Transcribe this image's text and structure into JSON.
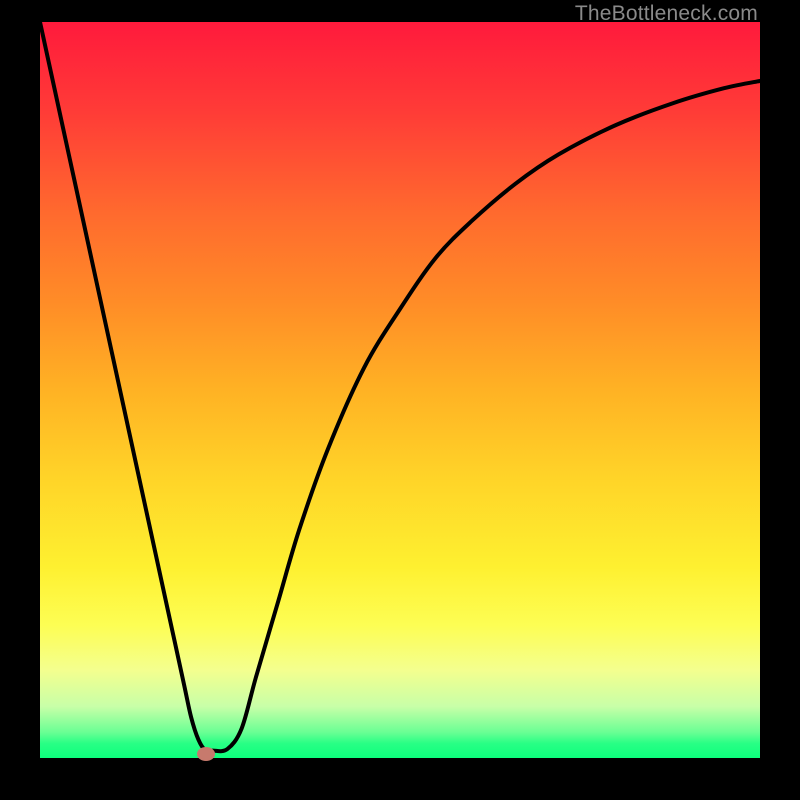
{
  "watermark": "TheBottleneck.com",
  "chart_data": {
    "type": "line",
    "title": "",
    "xlabel": "",
    "ylabel": "",
    "xlim": [
      0,
      100
    ],
    "ylim": [
      0,
      100
    ],
    "background_gradient": {
      "direction": "vertical",
      "stops": [
        {
          "pos": 0,
          "color": "#ff1a3c"
        },
        {
          "pos": 50,
          "color": "#ffb224"
        },
        {
          "pos": 82,
          "color": "#fdfe54"
        },
        {
          "pos": 100,
          "color": "#0cff7c"
        }
      ]
    },
    "series": [
      {
        "name": "bottleneck-curve",
        "color": "#000000",
        "x": [
          0,
          2,
          4,
          6,
          8,
          10,
          12,
          14,
          16,
          18,
          20,
          21,
          22,
          23,
          24,
          26,
          28,
          30,
          33,
          36,
          40,
          45,
          50,
          55,
          60,
          66,
          72,
          80,
          88,
          95,
          100
        ],
        "y": [
          100,
          91,
          82,
          73,
          64,
          55,
          46,
          37,
          28,
          19,
          10,
          5.5,
          2.5,
          1,
          1,
          1.2,
          4,
          11,
          21,
          31,
          42,
          53,
          61,
          68,
          73,
          78,
          82,
          86,
          89,
          91,
          92
        ]
      }
    ],
    "marker": {
      "x": 23,
      "y": 0.5,
      "color": "#c77a6d"
    }
  }
}
